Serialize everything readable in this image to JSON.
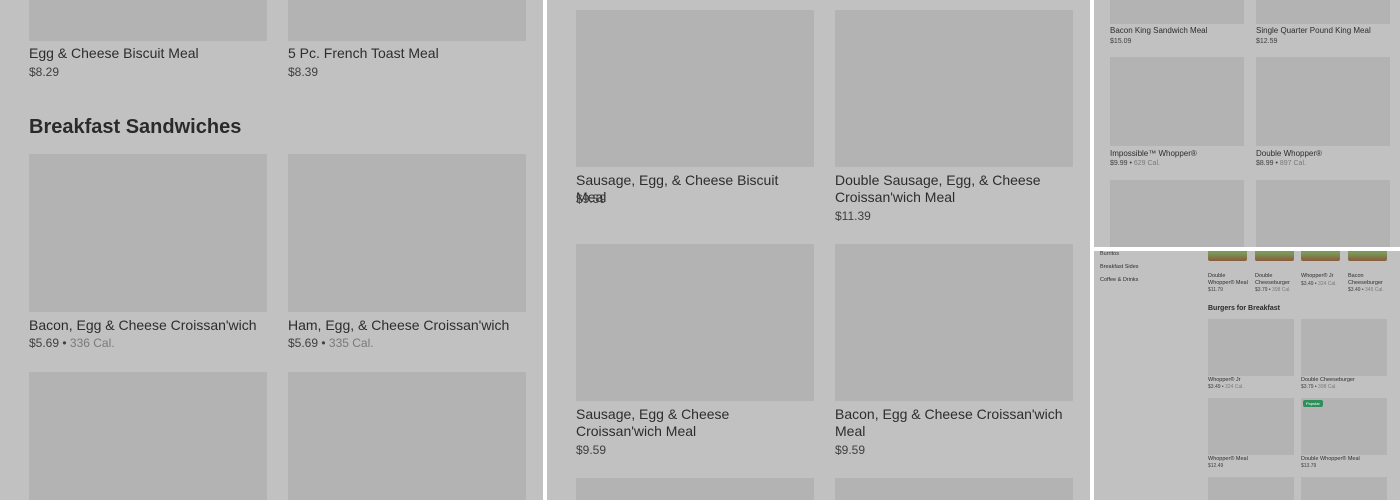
{
  "panel1": {
    "top_items": [
      {
        "name": "Egg & Cheese Biscuit Meal",
        "price": "$8.29"
      },
      {
        "name": "5 Pc. French Toast Meal",
        "price": "$8.39"
      }
    ],
    "section_title": "Breakfast Sandwiches",
    "items": [
      {
        "name": "Bacon, Egg & Cheese Croissan'wich",
        "price": "$5.69",
        "calories": "336 Cal."
      },
      {
        "name": "Ham, Egg, & Cheese Croissan'wich",
        "price": "$5.69",
        "calories": "335 Cal."
      }
    ]
  },
  "panel2": {
    "items": [
      {
        "name": "Sausage, Egg, & Cheese Biscuit Meal",
        "price": "$9.59"
      },
      {
        "name": "Double Sausage, Egg, & Cheese Croissan'wich Meal",
        "price": "$11.39"
      },
      {
        "name": "Sausage, Egg & Cheese Croissan'wich Meal",
        "price": "$9.59"
      },
      {
        "name": "Bacon, Egg & Cheese Croissan'wich Meal",
        "price": "$9.59"
      }
    ]
  },
  "panel3": {
    "items": [
      {
        "name": "Bacon King Sandwich Meal",
        "price": "$15.09"
      },
      {
        "name": "Single Quarter Pound King Meal",
        "price": "$12.59"
      },
      {
        "name": "Impossible™ Whopper®",
        "price": "$9.99",
        "calories": "629 Cal."
      },
      {
        "name": "Double Whopper®",
        "price": "$8.99",
        "calories": "897 Cal."
      }
    ]
  },
  "panel4": {
    "sidebar": [
      "Burritos",
      "Breakfast Sides",
      "Coffee & Drinks"
    ],
    "top_items": [
      {
        "name": "Double Whopper® Meal",
        "price": "$11.79"
      },
      {
        "name": "Double Cheeseburger",
        "price": "$3.79",
        "calories": "398 Cal."
      },
      {
        "name": "Whopper® Jr",
        "price": "$3.49",
        "calories": "324 Cal."
      },
      {
        "name": "Bacon Cheeseburger",
        "price": "$3.49",
        "calories": "345 Cal."
      }
    ],
    "section_title": "Burgers for Breakfast",
    "items": [
      {
        "name": "Whopper® Jr",
        "price": "$3.49",
        "calories": "324 Cal."
      },
      {
        "name": "Double Cheeseburger",
        "price": "$3.79",
        "calories": "398 Cal."
      },
      {
        "name": "Whopper® Meal",
        "price": "$12.49"
      },
      {
        "name": "Double Whopper® Meal",
        "price": "$13.79"
      }
    ],
    "popular_badge": "Popular"
  },
  "colors": {
    "overlay": "#c1c1c1",
    "placeholder": "#b3b3b3",
    "badge": "#2f8f5b"
  }
}
